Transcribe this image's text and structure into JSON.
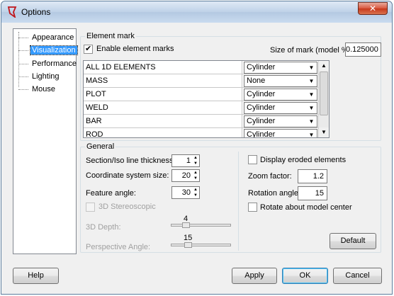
{
  "window": {
    "title": "Options",
    "close_label": "✕"
  },
  "tree": {
    "items": [
      {
        "label": "Appearance",
        "selected": false
      },
      {
        "label": "Visualization",
        "selected": true
      },
      {
        "label": "Performance",
        "selected": false
      },
      {
        "label": "Lighting",
        "selected": false
      },
      {
        "label": "Mouse",
        "selected": false
      }
    ]
  },
  "element_mark": {
    "group_label": "Element mark",
    "enable_label": "Enable element marks",
    "enable_checked": true,
    "size_label": "Size of mark (model %):",
    "size_value": "0.125000",
    "rows": [
      {
        "name": "ALL 1D ELEMENTS",
        "mark": "Cylinder"
      },
      {
        "name": "MASS",
        "mark": "None"
      },
      {
        "name": "PLOT",
        "mark": "Cylinder"
      },
      {
        "name": "WELD",
        "mark": "Cylinder"
      },
      {
        "name": "BAR",
        "mark": "Cylinder"
      },
      {
        "name": "ROD",
        "mark": "Cylinder"
      }
    ]
  },
  "general": {
    "group_label": "General",
    "section_thickness_label": "Section/Iso line thickness:",
    "section_thickness_value": "1",
    "coord_size_label": "Coordinate system size:",
    "coord_size_value": "20",
    "feature_angle_label": "Feature angle:",
    "feature_angle_value": "30",
    "stereo_label": "3D Stereoscopic",
    "depth_label": "3D Depth:",
    "depth_value": "4",
    "persp_label": "Perspective Angle:",
    "persp_value": "15",
    "display_eroded_label": "Display eroded elements",
    "zoom_label": "Zoom factor:",
    "zoom_value": "1.2",
    "rotation_label": "Rotation angle:",
    "rotation_value": "15",
    "rotate_center_label": "Rotate about model center",
    "default_button": "Default"
  },
  "footer": {
    "help": "Help",
    "apply": "Apply",
    "ok": "OK",
    "cancel": "Cancel"
  }
}
